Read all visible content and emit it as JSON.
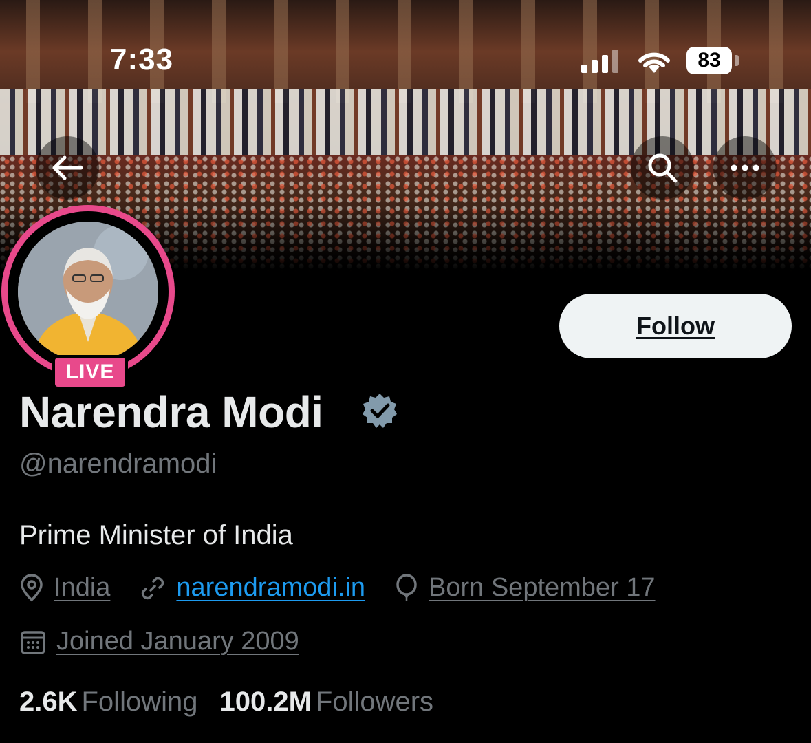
{
  "status_bar": {
    "time": "7:33",
    "battery": "83",
    "signal_icon": "cellular-signal-icon",
    "wifi_icon": "wifi-icon"
  },
  "nav": {
    "back_icon": "arrow-left-icon",
    "search_icon": "search-icon",
    "more_icon": "more-horizontal-icon"
  },
  "avatar": {
    "live_label": "LIVE",
    "ring_color": "#e8498b"
  },
  "follow_button": {
    "label": "Follow"
  },
  "profile": {
    "display_name": "Narendra Modi",
    "handle": "@narendramodi",
    "bio": "Prime Minister of India",
    "location": "India",
    "website": "narendramodi.in",
    "birthday": "Born September 17",
    "joined": "Joined January 2009"
  },
  "stats": {
    "following_count": "2.6K",
    "following_label": "Following",
    "followers_count": "100.2M",
    "followers_label": "Followers"
  },
  "colors": {
    "background": "#000000",
    "primary_text": "#e7e9ea",
    "secondary_text": "#71767b",
    "link": "#1d9bf0",
    "verified_badge": "#829aab"
  }
}
